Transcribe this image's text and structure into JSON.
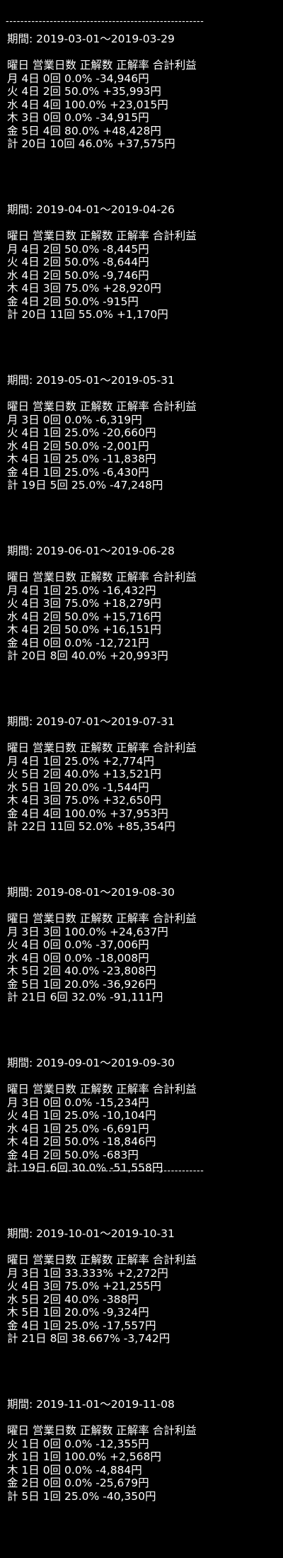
{
  "rule_text": "------------------------------------------------------",
  "header": "曜日 営業日数 正解数 正解率 合計利益",
  "periods": [
    {
      "title": "期間: 2019-03-01～2019-03-29",
      "rows": [
        "月 4日 0回 0.0% -34,946円",
        "火 4日 2回 50.0% +35,993円",
        "水 4日 4回 100.0% +23,015円",
        "木 3日 0回 0.0% -34,915円",
        "金 5日 4回 80.0% +48,428円",
        "計 20日 10回 46.0% +37,575円"
      ]
    },
    {
      "title": "期間: 2019-04-01～2019-04-26",
      "rows": [
        "月 4日 2回 50.0% -8,445円",
        "火 4日 2回 50.0% -8,644円",
        "水 4日 2回 50.0% -9,746円",
        "木 4日 3回 75.0% +28,920円",
        "金 4日 2回 50.0% -915円",
        "計 20日 11回 55.0% +1,170円"
      ]
    },
    {
      "title": "期間: 2019-05-01～2019-05-31",
      "rows": [
        "月 3日 0回 0.0% -6,319円",
        "火 4日 1回 25.0% -20,660円",
        "水 4日 2回 50.0% -2,001円",
        "木 4日 1回 25.0% -11,838円",
        "金 4日 1回 25.0% -6,430円",
        "計 19日 5回 25.0% -47,248円"
      ]
    },
    {
      "title": "期間: 2019-06-01～2019-06-28",
      "rows": [
        "月 4日 1回 25.0% -16,432円",
        "火 4日 3回 75.0% +18,279円",
        "水 4日 2回 50.0% +15,716円",
        "木 4日 2回 50.0% +16,151円",
        "金 4日 0回 0.0% -12,721円",
        "計 20日 8回 40.0% +20,993円"
      ]
    },
    {
      "title": "期間: 2019-07-01～2019-07-31",
      "rows": [
        "月 4日 1回 25.0% +2,774円",
        "火 5日 2回 40.0% +13,521円",
        "水 5日 1回 20.0% -1,544円",
        "木 4日 3回 75.0% +32,650円",
        "金 4日 4回 100.0% +37,953円",
        "計 22日 11回 52.0% +85,354円"
      ]
    },
    {
      "title": "期間: 2019-08-01～2019-08-30",
      "rows": [
        "月 3日 3回 100.0% +24,637円",
        "火 4日 0回 0.0% -37,006円",
        "水 4日 0回 0.0% -18,008円",
        "木 5日 2回 40.0% -23,808円",
        "金 5日 1回 20.0% -36,926円",
        "計 21日 6回 32.0% -91,111円"
      ]
    },
    {
      "title": "期間: 2019-09-01～2019-09-30",
      "rows": [
        "月 3日 0回 0.0% -15,234円",
        "火 4日 1回 25.0% -10,104円",
        "水 4日 1回 25.0% -6,691円",
        "木 4日 2回 50.0% -18,846円",
        "金 4日 2回 50.0% -683円",
        "計 19日 6回 30.0% -51,558円"
      ]
    },
    {
      "title": "期間: 2019-10-01～2019-10-31",
      "rows": [
        "月 3日 1回 33.333% +2,272円",
        "火 4日 3回 75.0% +21,255円",
        "水 5日 2回 40.0% -388円",
        "木 5日 1回 20.0% -9,324円",
        "金 4日 1回 25.0% -17,557円",
        "計 21日 8回 38.667% -3,742円"
      ]
    },
    {
      "title": "期間: 2019-11-01～2019-11-08",
      "rows": [
        "火 1日 0回 0.0% -12,355円",
        "水 1日 1回 100.0% +2,568円",
        "木 1日 0回 0.0% -4,884円",
        "金 2日 0回 0.0% -25,679円",
        "計 5日 1回 25.0% -40,350円"
      ]
    }
  ]
}
